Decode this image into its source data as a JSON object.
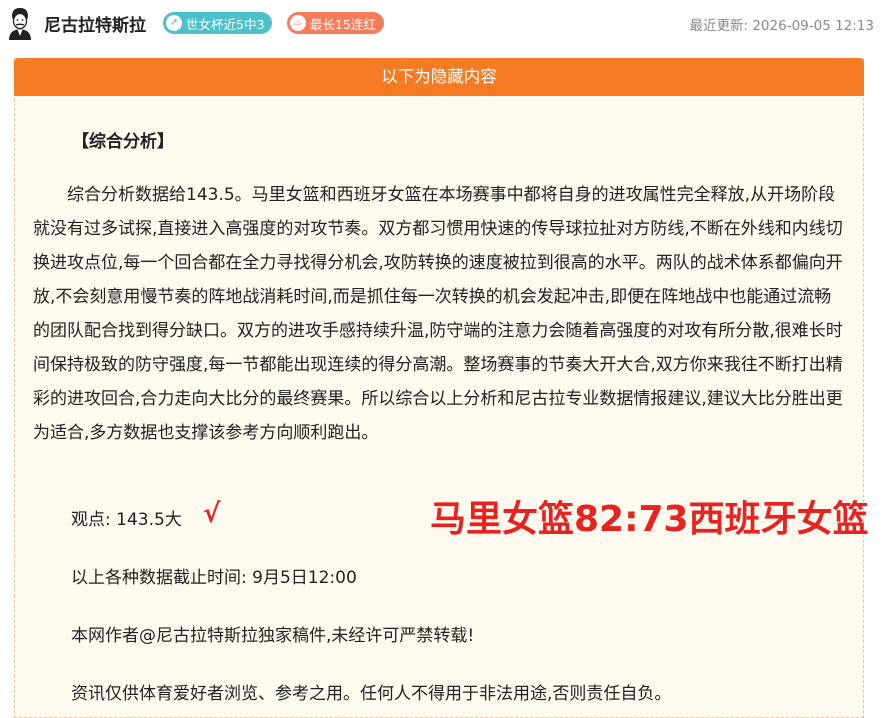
{
  "header": {
    "author_name": "尼古拉特斯拉",
    "avatar_icon": "tesla-portrait-icon",
    "badges": [
      {
        "label": "世女杯近5中3",
        "icon": "target-arrow-icon",
        "color": "#4cc1c9"
      },
      {
        "label": "最长15连红",
        "icon": "flame-icon",
        "color": "#f77c5a"
      }
    ],
    "updated_label": "最近更新: 2026-09-05 12:13"
  },
  "hidden_section": {
    "banner": "以下为隐藏内容",
    "banner_color": "#f67b22"
  },
  "article": {
    "section_title": "【综合分析】",
    "analysis_text": "综合分析数据给143.5。马里女篮和西班牙女篮在本场赛事中都将自身的进攻属性完全释放,从开场阶段就没有过多试探,直接进入高强度的对攻节奏。双方都习惯用快速的传导球拉扯对方防线,不断在外线和内线切换进攻点位,每一个回合都在全力寻找得分机会,攻防转换的速度被拉到很高的水平。两队的战术体系都偏向开放,不会刻意用慢节奏的阵地战消耗时间,而是抓住每一次转换的机会发起冲击,即便在阵地战中也能通过流畅的团队配合找到得分缺口。双方的进攻手感持续升温,防守端的注意力会随着高强度的对攻有所分散,很难长时间保持极致的防守强度,每一节都能出现连续的得分高潮。整场赛事的节奏大开大合,双方你来我往不断打出精彩的进攻回合,合力走向大比分的最终赛果。所以综合以上分析和尼古拉专业数据情报建议,建议大比分胜出更为适合,多方数据也支撑该参考方向顺利跑出。",
    "viewpoint": "观点: 143.5大",
    "check_mark": "√",
    "result_stamp": "马里女篮82:73西班牙女篮",
    "result_color": "#e8231f",
    "cutoff": "以上各种数据截止时间: 9月5日12:00",
    "copyright": "本网作者@尼古拉特斯拉独家稿件,未经许可严禁转载!",
    "disclaimer": "资讯仅供体育爱好者浏览、参考之用。任何人不得用于非法用途,否则责任自负。"
  }
}
